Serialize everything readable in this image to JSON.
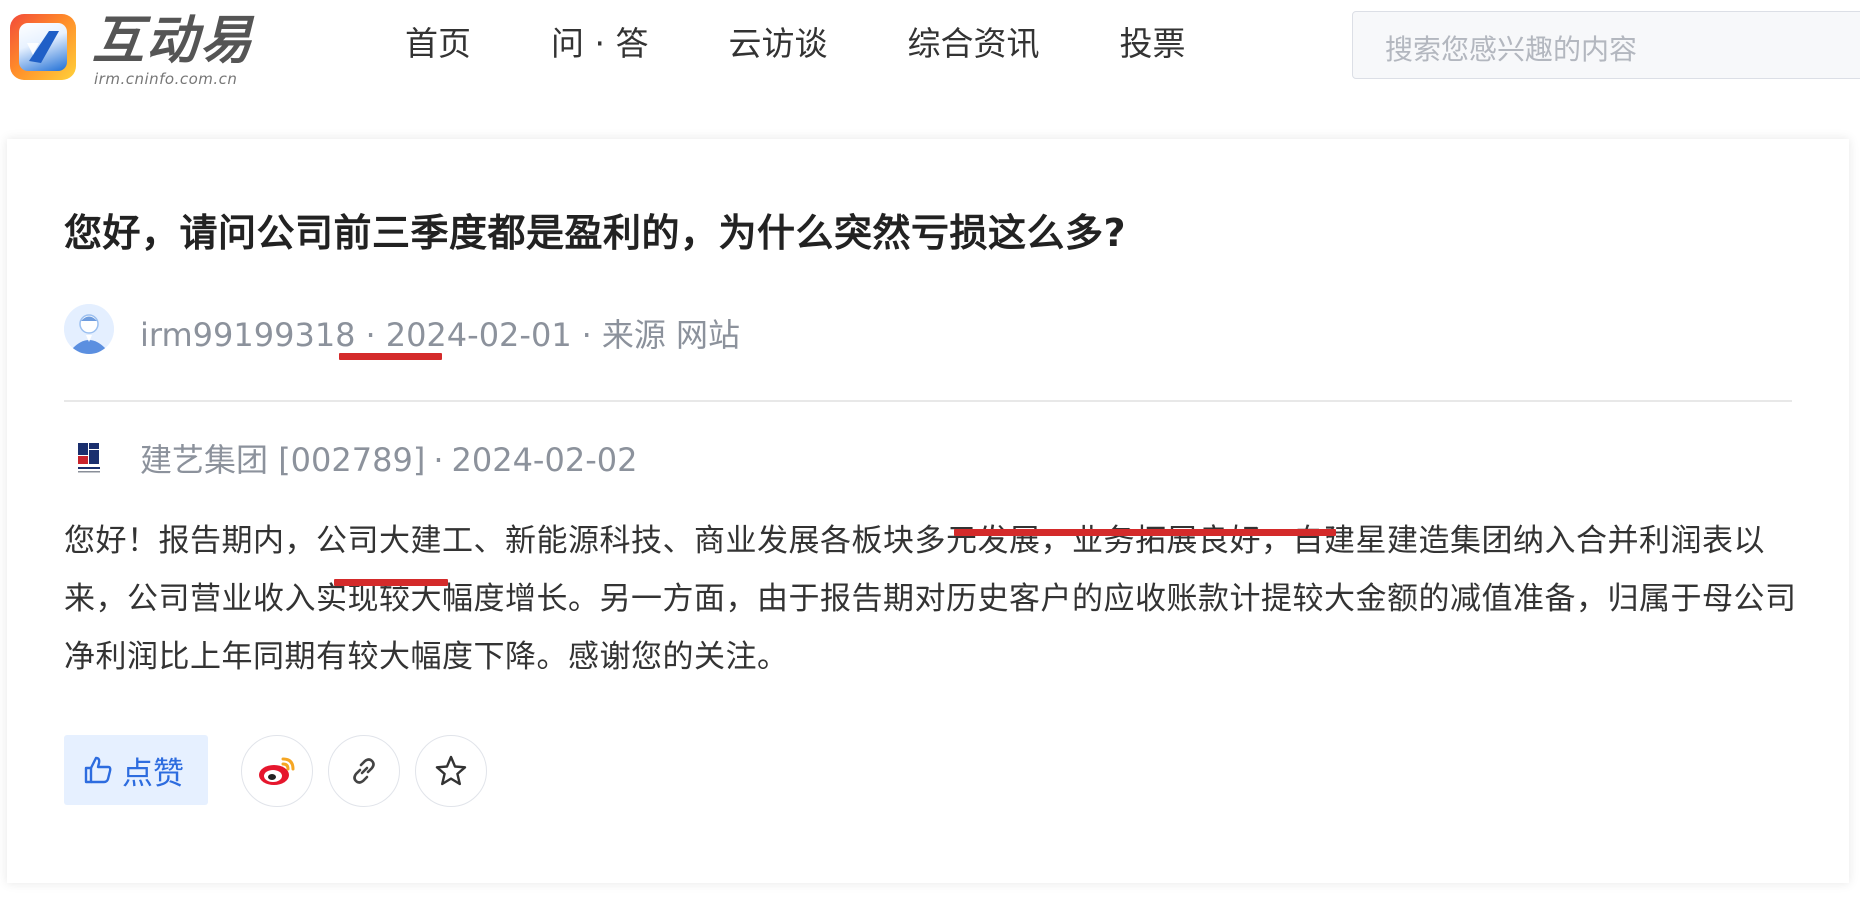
{
  "header": {
    "logo": {
      "name": "互动易",
      "sub": "irm.cninfo.com.cn"
    },
    "nav": [
      {
        "label": "首页"
      },
      {
        "label": "问 · 答"
      },
      {
        "label": "云访谈"
      },
      {
        "label": "综合资讯"
      },
      {
        "label": "投票"
      }
    ],
    "search": {
      "placeholder": "搜索您感兴趣的内容"
    }
  },
  "question": {
    "title": "您好，请问公司前三季度都是盈利的，为什么突然亏损这么多?",
    "user": "irm99199318",
    "date": "2024-02-01",
    "source": "来源 网站"
  },
  "answer": {
    "company": "建艺集团",
    "code": "[002789]",
    "date": "2024-02-02",
    "body_part1": "您好！报告期内，公司大建工、新能源科技、商业发展各板块多元发展，业务拓展良好，自建星建造集团纳入合并利润表以来，公司营业收入实现较大幅度增长。另一方面，由于报告期对历史客户的",
    "body_highlight1": "应收账款计提较大金额的减值准备",
    "body_part2": "，归属于母公司净利润比上年同期有",
    "body_highlight2": "较大幅度下降",
    "body_part3": "。感谢您的关注。"
  },
  "actions": {
    "like_label": "点赞",
    "share_icons": [
      "weibo-icon",
      "link-icon",
      "star-icon"
    ]
  },
  "colors": {
    "annotation_red": "#d42a2a",
    "accent_blue": "#2d6cdf",
    "like_bg": "#e6f0ff"
  }
}
